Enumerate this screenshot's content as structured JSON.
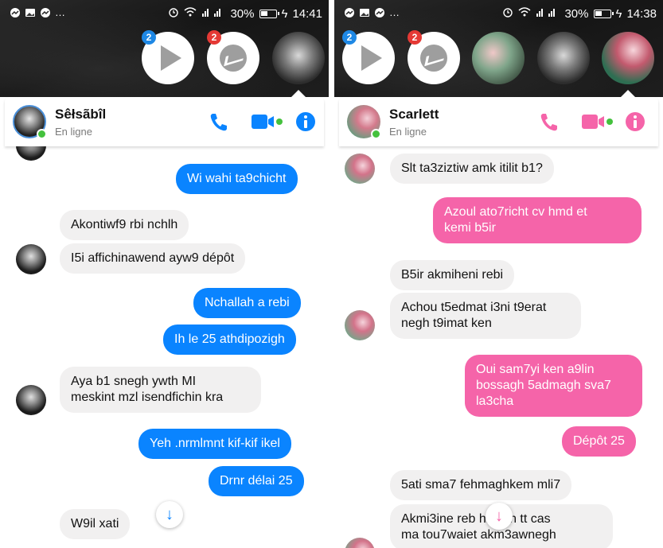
{
  "left": {
    "status_bar": {
      "battery": "30%",
      "time": "14:41",
      "signal": "̀́̀́"
    },
    "chat_heads": {
      "badge_video": "2",
      "badge_messenger": "2"
    },
    "header": {
      "name": "Sêłsãbîl",
      "status": "En ligne"
    },
    "accent": "#0a84ff",
    "messages": [
      {
        "text": "Wi wahi ta9chicht"
      },
      {
        "text": "Akontiwf9 rbi nchlh"
      },
      {
        "text": "I5i affichinawend ayw9 dépôt"
      },
      {
        "text": "Nchallah a rebi"
      },
      {
        "text": "Ih le 25 athdipozigh"
      },
      {
        "text": "Aya b1 snegh ywth MI\nmeskint mzl isendfichin kra"
      },
      {
        "text": "Yeh .nrmlmnt kif-kif ikel"
      },
      {
        "text": "Drnr délai 25"
      },
      {
        "text": "W9il xati"
      }
    ]
  },
  "right": {
    "status_bar": {
      "battery": "30%",
      "time": "14:38"
    },
    "chat_heads": {
      "badge_video": "2",
      "badge_messenger": "2"
    },
    "header": {
      "name": "Scarlett",
      "status": "En ligne"
    },
    "accent": "#f564a9",
    "messages": [
      {
        "text": "Slt ta3ziztiw amk itilit b1?"
      },
      {
        "text": "Azoul ato7richt cv hmd  et\nkemi b5ir"
      },
      {
        "text": "B5ir akmiheni rebi"
      },
      {
        "text": "Achou t5edmat i3ni t9erat\nnegh t9imat ken"
      },
      {
        "text": "Oui sam7yi ken a9lin\nbossagh 5admagh sva7\nla3cha"
      },
      {
        "text": "Dépôt 25"
      },
      {
        "text": "5ati sma7 fehmaghkem mli7"
      },
      {
        "text": "Akmi3ine reb    hllh en tt cas\nma tou7waiet akm3awnegh"
      }
    ]
  },
  "icons": {
    "status_left": [
      "messenger-icon",
      "gallery-icon",
      "messenger-icon"
    ],
    "status_right": [
      "alarm-icon",
      "wifi-icon",
      "signal-icon",
      "battery-icon"
    ],
    "header": [
      "phone-icon",
      "video-camera-icon",
      "info-icon"
    ],
    "scroll": "arrow-down-icon"
  }
}
